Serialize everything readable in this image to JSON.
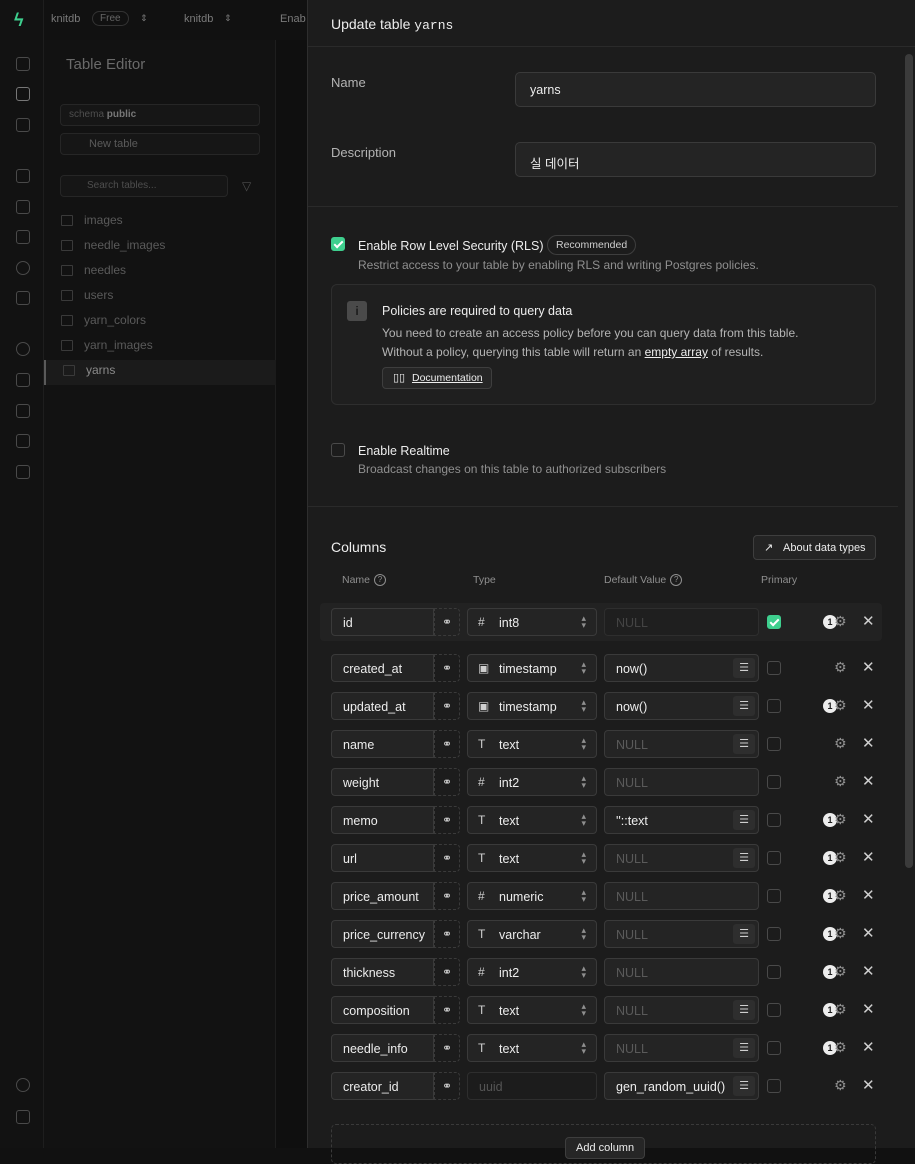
{
  "topbar": {
    "project": "knitdb",
    "plan": "Free",
    "branch": "knitdb",
    "extra": "Enab"
  },
  "sidebar": {
    "title": "Table Editor",
    "schema_label": "schema",
    "schema_value": "public",
    "new_table": "New table",
    "search_placeholder": "Search tables...",
    "tables": [
      "images",
      "needle_images",
      "needles",
      "users",
      "yarn_colors",
      "yarn_images",
      "yarns"
    ]
  },
  "panel": {
    "title_prefix": "Update table",
    "title_table": "yarns",
    "name_label": "Name",
    "name_value": "yarns",
    "description_label": "Description",
    "description_value": "실 데이터",
    "rls_label": "Enable Row Level Security (RLS)",
    "rls_badge": "Recommended",
    "rls_sub": "Restrict access to your table by enabling RLS and writing Postgres policies.",
    "alert_title": "Policies are required to query data",
    "alert_line1": "You need to create an access policy before you can query data from this table.",
    "alert_line2_a": "Without a policy, querying this table will return an",
    "alert_line2_link": "empty array",
    "alert_line2_b": "of results.",
    "doc_button": "Documentation",
    "realtime_label": "Enable Realtime",
    "realtime_sub": "Broadcast changes on this table to authorized subscribers",
    "columns_title": "Columns",
    "about_button": "About data types",
    "col_headers": {
      "name": "Name",
      "type": "Type",
      "default": "Default Value",
      "primary": "Primary"
    },
    "add_column": "Add column",
    "columns": [
      {
        "name": "id",
        "type": "int8",
        "icon": "#",
        "default": "NULL",
        "badge": "1"
      },
      {
        "name": "created_at",
        "type": "timestamp",
        "icon": "cal",
        "default": "now()",
        "badge": ""
      },
      {
        "name": "updated_at",
        "type": "timestamp",
        "icon": "cal",
        "default": "now()",
        "badge": "1"
      },
      {
        "name": "name",
        "type": "text",
        "icon": "T",
        "default": "NULL",
        "badge": ""
      },
      {
        "name": "weight",
        "type": "int2",
        "icon": "#",
        "default": "NULL",
        "badge": ""
      },
      {
        "name": "memo",
        "type": "text",
        "icon": "T",
        "default": "''::text",
        "badge": "1"
      },
      {
        "name": "url",
        "type": "text",
        "icon": "T",
        "default": "NULL",
        "badge": "1"
      },
      {
        "name": "price_amount",
        "type": "numeric",
        "icon": "#",
        "default": "NULL",
        "badge": "1"
      },
      {
        "name": "price_currency",
        "type": "varchar",
        "icon": "T",
        "default": "NULL",
        "badge": "1"
      },
      {
        "name": "thickness",
        "type": "int2",
        "icon": "#",
        "default": "NULL",
        "badge": "1"
      },
      {
        "name": "composition",
        "type": "text",
        "icon": "T",
        "default": "NULL",
        "badge": "1"
      },
      {
        "name": "needle_info",
        "type": "text",
        "icon": "T",
        "default": "NULL",
        "badge": "1"
      },
      {
        "name": "creator_id",
        "type": "uuid",
        "icon": "",
        "default": "gen_random_uuid()",
        "badge": ""
      }
    ]
  },
  "colors": {
    "accent": "#3ecf8e",
    "panel_bg": "#1c1c1c",
    "input_bg": "#242424"
  }
}
